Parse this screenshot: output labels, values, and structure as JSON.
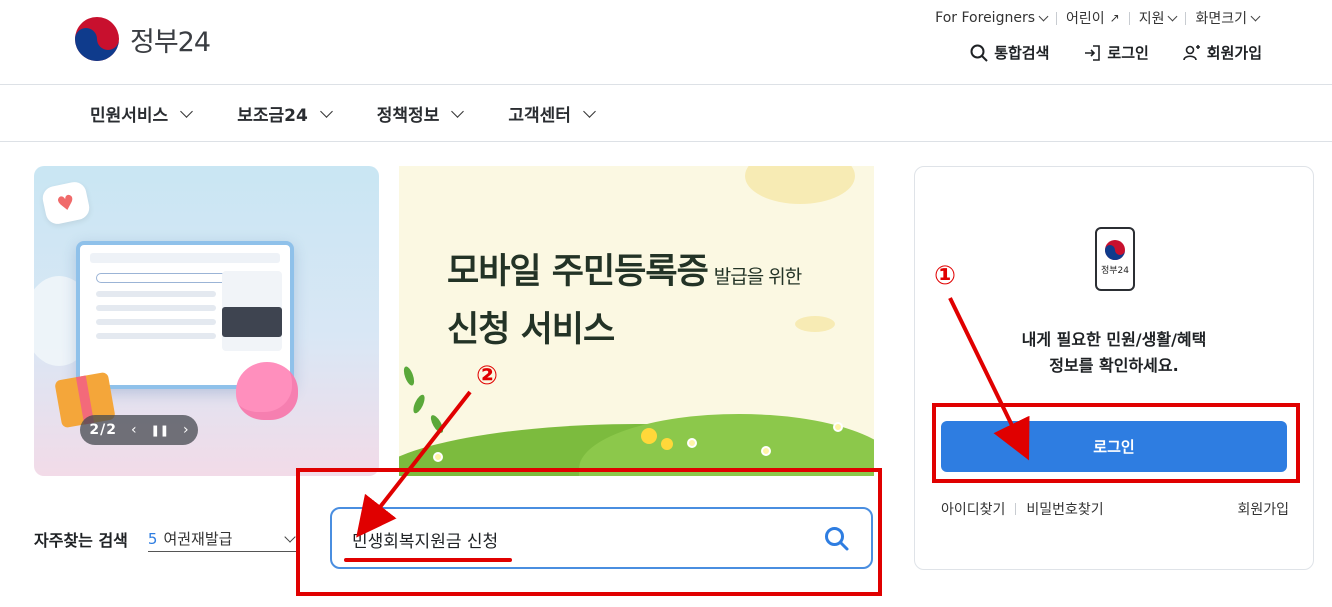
{
  "header": {
    "logo_text": "정부24",
    "utility": [
      {
        "label": "For Foreigners"
      },
      {
        "label": "어린이"
      },
      {
        "label": "지원"
      },
      {
        "label": "화면크기"
      }
    ],
    "account": {
      "search_label": "통합검색",
      "login_label": "로그인",
      "signup_label": "회원가입"
    }
  },
  "gnb": [
    {
      "label": "민원서비스"
    },
    {
      "label": "보조금24"
    },
    {
      "label": "정책정보"
    },
    {
      "label": "고객센터"
    }
  ],
  "banner1": {
    "counter": "2/2"
  },
  "banner2": {
    "title_big_1": "모바일 주민등록증",
    "title_small": "발급을 위한",
    "title_big_2": "신청 서비스"
  },
  "login_panel": {
    "phone_label": "정부24",
    "message_line1": "내게 필요한 민원/생활/혜택",
    "message_line2": "정보를 확인하세요.",
    "button_label": "로그인",
    "find_id": "아이디찾기",
    "find_pw": "비밀번호찾기",
    "signup": "회원가입"
  },
  "frequent_search": {
    "label": "자주찾는 검색",
    "rank": "5",
    "keyword": "여권재발급"
  },
  "search": {
    "value": "민생회복지원금 신청"
  },
  "annotations": {
    "step1": "①",
    "step2": "②",
    "color": "#e00000"
  },
  "colors": {
    "accent": "#2e7de1",
    "annotation": "#e00000"
  }
}
